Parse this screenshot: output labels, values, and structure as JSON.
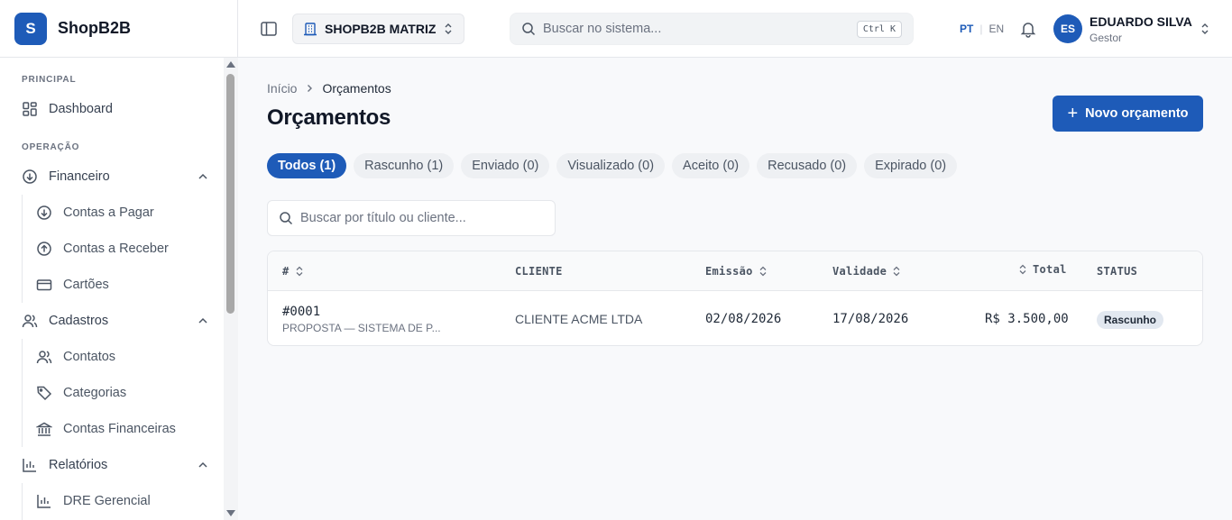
{
  "brand": {
    "logo_letter": "S",
    "name": "ShopB2B",
    "color": "#1e5bb8"
  },
  "sidebar": {
    "sections": [
      {
        "label": "PRINCIPAL"
      },
      {
        "label": "OPERAÇÃO"
      }
    ],
    "items": {
      "dashboard": "Dashboard",
      "financeiro": "Financeiro",
      "contas_pagar": "Contas a Pagar",
      "contas_receber": "Contas a Receber",
      "cartoes": "Cartões",
      "cadastros": "Cadastros",
      "contatos": "Contatos",
      "categorias": "Categorias",
      "contas_financeiras": "Contas Financeiras",
      "relatorios": "Relatórios",
      "dre": "DRE Gerencial"
    }
  },
  "header": {
    "company": "SHOPB2B MATRIZ",
    "search_placeholder": "Buscar no sistema...",
    "shortcut": "Ctrl K",
    "lang_active": "PT",
    "lang_sep": "|",
    "lang_other": "EN",
    "user_initials": "ES",
    "user_name": "EDUARDO SILVA",
    "user_role": "Gestor"
  },
  "breadcrumb": {
    "home": "Início",
    "current": "Orçamentos"
  },
  "page": {
    "title": "Orçamentos",
    "new_button": "Novo orçamento",
    "filter_placeholder": "Buscar por título ou cliente..."
  },
  "tabs": [
    {
      "label": "Todos (1)",
      "active": true
    },
    {
      "label": "Rascunho (1)"
    },
    {
      "label": "Enviado (0)"
    },
    {
      "label": "Visualizado (0)"
    },
    {
      "label": "Aceito (0)"
    },
    {
      "label": "Recusado (0)"
    },
    {
      "label": "Expirado (0)"
    }
  ],
  "table": {
    "columns": {
      "num": "#",
      "cliente": "CLIENTE",
      "emissao": "Emissão",
      "validade": "Validade",
      "total": "Total",
      "status": "STATUS"
    },
    "rows": [
      {
        "num": "#0001",
        "title": "PROPOSTA — SISTEMA DE P...",
        "cliente": "CLIENTE ACME LTDA",
        "emissao": "02/08/2026",
        "validade": "17/08/2026",
        "total": "R$ 3.500,00",
        "status": "Rascunho"
      }
    ]
  }
}
